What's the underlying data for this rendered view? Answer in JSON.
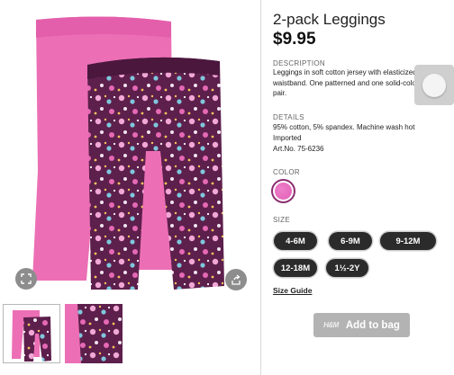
{
  "product": {
    "title": "2-pack Leggings",
    "price": "$9.95"
  },
  "description": {
    "label": "DESCRIPTION",
    "text": "Leggings in soft cotton jersey with elasticized waistband. One patterned and one solid-colored pair."
  },
  "details": {
    "label": "DETAILS",
    "lines": [
      "95% cotton, 5% spandex. Machine wash hot",
      "Imported",
      "Art.No. 75-6236"
    ]
  },
  "color": {
    "label": "COLOR",
    "swatch": "#e86bbf"
  },
  "size": {
    "label": "SIZE",
    "options": [
      "4-6M",
      "6-9M",
      "9-12M",
      "12-18M",
      "1½-2Y"
    ]
  },
  "size_guide": "Size Guide",
  "add_to_bag": {
    "label": "Add to bag",
    "logo": "H&M"
  },
  "icons": {
    "expand": "expand-icon",
    "share": "share-icon"
  },
  "colors": {
    "pink": "#ec6fb5",
    "purple": "#5a1f4a",
    "button_dark": "#2b2b2b",
    "button_disabled": "#b3b3b3"
  }
}
